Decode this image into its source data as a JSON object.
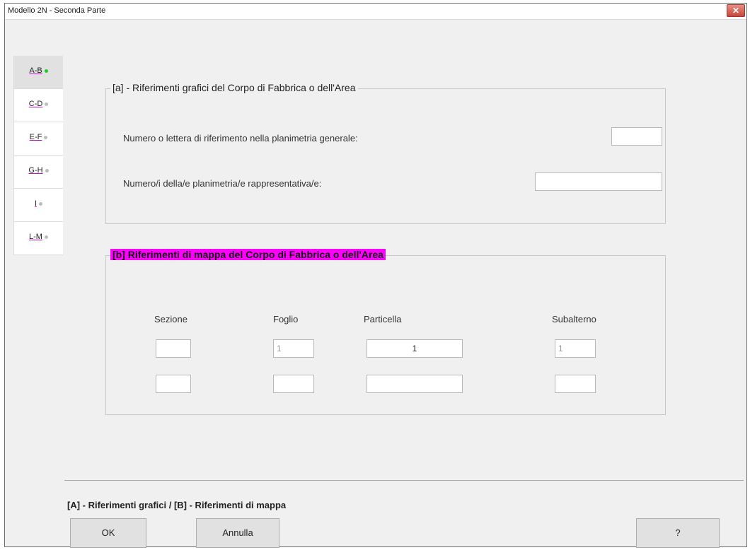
{
  "window": {
    "title": "Modello 2N - Seconda Parte",
    "close_glyph": "✕"
  },
  "tabs": [
    {
      "label": "A-B",
      "status_color": "#22cc22",
      "active": true
    },
    {
      "label": "C-D",
      "status_color": "#bdbdbd",
      "active": false
    },
    {
      "label": "E-F",
      "status_color": "#bdbdbd",
      "active": false
    },
    {
      "label": "G-H",
      "status_color": "#bdbdbd",
      "active": false
    },
    {
      "label": "I",
      "status_color": "#bdbdbd",
      "active": false
    },
    {
      "label": "L-M",
      "status_color": "#bdbdbd",
      "active": false
    }
  ],
  "section_a": {
    "title": "[a] - Riferimenti grafici del Corpo di Fabbrica o dell'Area",
    "row1_label": "Numero o lettera di riferimento nella planimetria generale:",
    "row1_value": "",
    "row2_label": "Numero/i della/e planimetria/e rappresentativa/e:",
    "row2_value": ""
  },
  "section_b": {
    "title": "[b] Riferimenti di mappa del Corpo di Fabbrica o dell'Area",
    "title_highlight_color": "#ff00ff",
    "headers": {
      "sezione": "Sezione",
      "foglio": "Foglio",
      "particella": "Particella",
      "subalterno": "Subalterno"
    },
    "rows": [
      {
        "sezione": "",
        "foglio": "1",
        "particella": "1",
        "subalterno": "1"
      },
      {
        "sezione": "",
        "foglio": "",
        "particella": "",
        "subalterno": ""
      }
    ]
  },
  "footer": {
    "legend": "[A] - Riferimenti grafici / [B] - Riferimenti di mappa",
    "ok_label": "OK",
    "cancel_label": "Annulla",
    "help_label": "?"
  }
}
